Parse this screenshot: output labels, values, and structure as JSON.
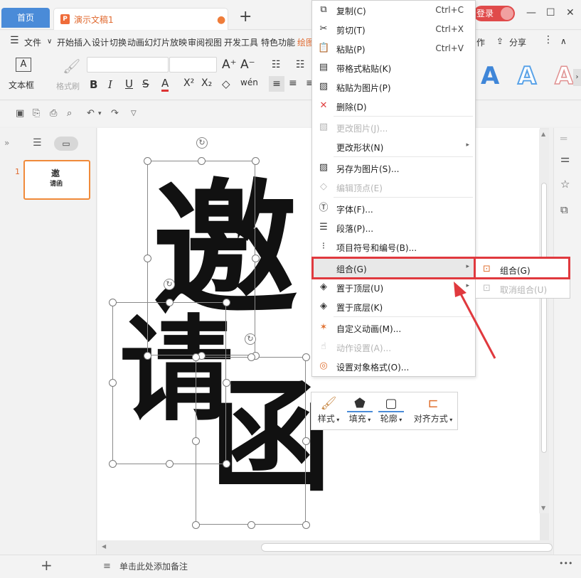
{
  "titlebar": {
    "home_tab": "首页",
    "doc_tab": "演示文稿1",
    "add_tab": "+",
    "login": "登录",
    "minimize": "—",
    "restore": "☐",
    "close": "✕"
  },
  "menubar": {
    "file": "文件",
    "items": [
      "开始",
      "插入",
      "设计",
      "切换",
      "动画",
      "幻灯片放映",
      "审阅",
      "视图",
      "开发工具",
      "特色功能",
      "绘图"
    ],
    "partial_right": "作",
    "share": "分享"
  },
  "ribbon": {
    "textbox": "文本框",
    "format_painter": "格式刷",
    "wordart_letter": "A"
  },
  "slides": {
    "number": "1",
    "thumb_text_1": "邀",
    "thumb_text_2": "请函"
  },
  "content": {
    "char1": "邀",
    "char2": "请",
    "char3": "函"
  },
  "context_menu": {
    "items": [
      {
        "label": "复制(C)",
        "shortcut": "Ctrl+C",
        "icon": "copy-icon"
      },
      {
        "label": "剪切(T)",
        "shortcut": "Ctrl+X",
        "icon": "cut-icon"
      },
      {
        "label": "粘贴(P)",
        "shortcut": "Ctrl+V",
        "icon": "paste-icon"
      },
      {
        "label": "带格式粘贴(K)",
        "icon": "paste-format-icon"
      },
      {
        "label": "粘贴为图片(P)",
        "icon": "paste-picture-icon"
      },
      {
        "label": "删除(D)",
        "icon": "delete-icon"
      },
      {
        "label": "更改图片(J)...",
        "icon": "change-picture-icon",
        "disabled": true
      },
      {
        "label": "更改形状(N)",
        "icon": "",
        "submenu": true
      },
      {
        "label": "另存为图片(S)...",
        "icon": "save-picture-icon"
      },
      {
        "label": "编辑顶点(E)",
        "icon": "edit-points-icon",
        "disabled": true
      },
      {
        "label": "字体(F)...",
        "icon": "font-icon"
      },
      {
        "label": "段落(P)...",
        "icon": "paragraph-icon"
      },
      {
        "label": "项目符号和编号(B)...",
        "icon": "bullets-icon"
      },
      {
        "label": "组合(G)",
        "icon": "",
        "submenu": true,
        "highlight": true
      },
      {
        "label": "置于顶层(U)",
        "icon": "bring-front-icon",
        "submenu": true
      },
      {
        "label": "置于底层(K)",
        "icon": "send-back-icon"
      },
      {
        "label": "自定义动画(M)...",
        "icon": "animation-icon"
      },
      {
        "label": "动作设置(A)...",
        "icon": "action-icon",
        "disabled": true
      },
      {
        "label": "设置对象格式(O)...",
        "icon": "format-object-icon"
      }
    ],
    "submenu_group": "组合(G)",
    "submenu_ungroup": "取消组合(U)"
  },
  "mini_toolbar": {
    "style": "样式",
    "fill": "填充",
    "outline": "轮廓",
    "align": "对齐方式"
  },
  "status": {
    "notes": "单击此处添加备注",
    "more": "•••"
  },
  "colors": {
    "accent": "#4a8bd8",
    "doc_orange": "#e06a30",
    "red_highlight": "#e0393e"
  }
}
